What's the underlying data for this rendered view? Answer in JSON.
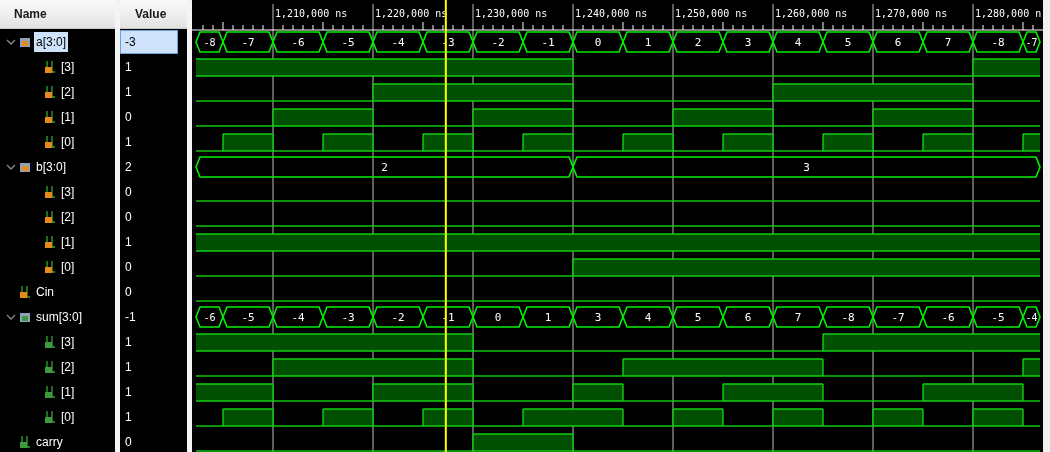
{
  "header": {
    "name": "Name",
    "value": "Value"
  },
  "timeline": {
    "labels": [
      "1,210,000 ns",
      "1,220,000 ns",
      "1,230,000 ns",
      "1,240,000 ns",
      "1,250,000 ns",
      "1,260,000 ns",
      "1,270,000 ns",
      "1,280,000 n"
    ]
  },
  "cursor": {
    "level": 0.296
  },
  "signals": [
    {
      "name": "a[3:0]",
      "value": "-3",
      "selected": true,
      "expanded": true,
      "color": "#e8891c",
      "segments": [
        "-8",
        "-7",
        "-6",
        "-5",
        "-4",
        "-3",
        "-2",
        "-1",
        "0",
        "1",
        "2",
        "3",
        "4",
        "5",
        "6",
        "7",
        "-8",
        "-7"
      ],
      "children": [
        {
          "name": "[3]",
          "value": "1",
          "selected": false,
          "color": "#e8891c",
          "high": [
            true,
            true,
            true,
            true,
            true,
            true,
            true,
            true,
            false,
            false,
            false,
            false,
            false,
            false,
            false,
            false,
            true,
            true
          ]
        },
        {
          "name": "[2]",
          "value": "1",
          "selected": false,
          "color": "#e8891c",
          "high": [
            false,
            false,
            false,
            false,
            true,
            true,
            true,
            true,
            false,
            false,
            false,
            false,
            true,
            true,
            true,
            true,
            false,
            false
          ]
        },
        {
          "name": "[1]",
          "value": "0",
          "selected": false,
          "color": "#e8891c",
          "high": [
            false,
            false,
            true,
            true,
            false,
            false,
            true,
            true,
            false,
            false,
            true,
            true,
            false,
            false,
            true,
            true,
            false,
            false
          ]
        },
        {
          "name": "[0]",
          "value": "1",
          "selected": false,
          "color": "#e8891c",
          "high": [
            false,
            true,
            false,
            true,
            false,
            true,
            false,
            true,
            false,
            true,
            false,
            true,
            false,
            true,
            false,
            true,
            false,
            true
          ]
        }
      ]
    },
    {
      "name": "b[3:0]",
      "value": "2",
      "selected": false,
      "expanded": true,
      "color": "#e8891c",
      "segments": [
        "2",
        "3"
      ],
      "children": [
        {
          "name": "[3]",
          "value": "0",
          "selected": false,
          "color": "#e8891c",
          "high": [
            false,
            false,
            false,
            false,
            false,
            false,
            false,
            false,
            false,
            false,
            false,
            false,
            false,
            false,
            false,
            false,
            false,
            false
          ]
        },
        {
          "name": "[2]",
          "value": "0",
          "selected": false,
          "color": "#e8891c",
          "high": [
            false,
            false,
            false,
            false,
            false,
            false,
            false,
            false,
            false,
            false,
            false,
            false,
            false,
            false,
            false,
            false,
            false,
            false
          ]
        },
        {
          "name": "[1]",
          "value": "1",
          "selected": false,
          "color": "#e8891c",
          "high": [
            true,
            true,
            true,
            true,
            true,
            true,
            true,
            true,
            true,
            true,
            true,
            true,
            true,
            true,
            true,
            true,
            true,
            true
          ]
        },
        {
          "name": "[0]",
          "value": "0",
          "selected": false,
          "color": "#e8891c",
          "high": [
            false,
            false,
            false,
            false,
            false,
            false,
            false,
            false,
            true,
            true,
            true,
            true,
            true,
            true,
            true,
            true,
            true,
            true
          ]
        }
      ]
    },
    {
      "name": "Cin",
      "value": "0",
      "selected": false,
      "color": "#e8891c",
      "high": [
        false,
        false,
        false,
        false,
        false,
        false,
        false,
        false,
        false,
        false,
        false,
        false,
        false,
        false,
        false,
        false,
        false,
        false
      ]
    },
    {
      "name": "sum[3:0]",
      "value": "-1",
      "selected": false,
      "expanded": true,
      "color": "#3f9a3f",
      "segments": [
        "-6",
        "-5",
        "-4",
        "-3",
        "-2",
        "-1",
        "0",
        "1",
        "3",
        "4",
        "5",
        "6",
        "7",
        "-8",
        "-7",
        "-6",
        "-5",
        "-4"
      ],
      "children": [
        {
          "name": "[3]",
          "value": "1",
          "selected": false,
          "color": "#3f9a3f",
          "high": [
            true,
            true,
            true,
            true,
            true,
            true,
            false,
            false,
            false,
            false,
            false,
            false,
            false,
            true,
            true,
            true,
            true,
            true
          ]
        },
        {
          "name": "[2]",
          "value": "1",
          "selected": false,
          "color": "#3f9a3f",
          "high": [
            false,
            false,
            true,
            true,
            true,
            true,
            false,
            false,
            false,
            true,
            true,
            true,
            true,
            false,
            false,
            false,
            false,
            true
          ]
        },
        {
          "name": "[1]",
          "value": "1",
          "selected": false,
          "color": "#3f9a3f",
          "high": [
            true,
            true,
            false,
            false,
            true,
            true,
            false,
            false,
            true,
            false,
            false,
            true,
            true,
            false,
            false,
            true,
            true,
            false
          ]
        },
        {
          "name": "[0]",
          "value": "1",
          "selected": false,
          "color": "#3f9a3f",
          "high": [
            false,
            true,
            false,
            true,
            false,
            true,
            false,
            true,
            true,
            false,
            true,
            false,
            true,
            false,
            true,
            false,
            true,
            false
          ]
        }
      ]
    },
    {
      "name": "carry",
      "value": "0",
      "selected": false,
      "color": "#3f9a3f",
      "high": [
        false,
        false,
        false,
        false,
        false,
        false,
        true,
        true,
        false,
        false,
        false,
        false,
        false,
        false,
        false,
        false,
        false,
        false
      ]
    }
  ]
}
